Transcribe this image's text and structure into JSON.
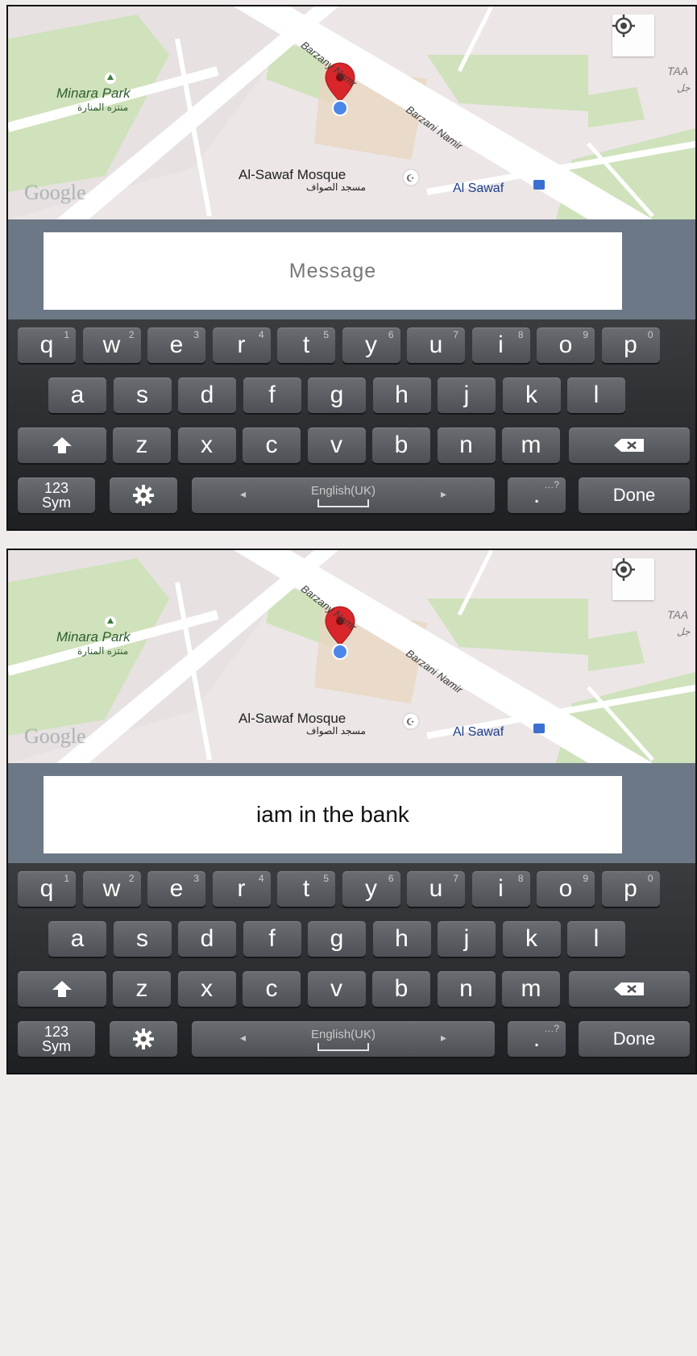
{
  "map": {
    "park_name": "Minara Park",
    "park_name_ar": "منتزه المنارة",
    "road_1": "Barzany Namr",
    "road_2": "Barzani Namir",
    "mosque_name": "Al-Sawaf Mosque",
    "mosque_name_ar": "مسجد الصواف",
    "bus_stop": "Al Sawaf",
    "edge_label": "TAA",
    "edge_label_ar": "جل",
    "watermark": "Google"
  },
  "panels": [
    {
      "message_text": "",
      "message_placeholder": "Message"
    },
    {
      "message_text": "iam in the bank",
      "message_placeholder": "Message"
    }
  ],
  "keyboard": {
    "row1": [
      {
        "label": "q",
        "hint": "1"
      },
      {
        "label": "w",
        "hint": "2"
      },
      {
        "label": "e",
        "hint": "3"
      },
      {
        "label": "r",
        "hint": "4"
      },
      {
        "label": "t",
        "hint": "5"
      },
      {
        "label": "y",
        "hint": "6"
      },
      {
        "label": "u",
        "hint": "7"
      },
      {
        "label": "i",
        "hint": "8"
      },
      {
        "label": "o",
        "hint": "9"
      },
      {
        "label": "p",
        "hint": "0"
      }
    ],
    "row2": [
      {
        "label": "a"
      },
      {
        "label": "s"
      },
      {
        "label": "d"
      },
      {
        "label": "f"
      },
      {
        "label": "g"
      },
      {
        "label": "h"
      },
      {
        "label": "j"
      },
      {
        "label": "k"
      },
      {
        "label": "l"
      }
    ],
    "row3": [
      {
        "label": "z"
      },
      {
        "label": "x"
      },
      {
        "label": "c"
      },
      {
        "label": "v"
      },
      {
        "label": "b"
      },
      {
        "label": "n"
      },
      {
        "label": "m"
      }
    ],
    "sym_top": "123",
    "sym_bottom": "Sym",
    "space_label": "English(UK)",
    "period": ".",
    "period_hint": "…?",
    "done": "Done",
    "icons": {
      "shift": "shift-arrow",
      "backspace": "backspace-x",
      "settings": "gear",
      "locate": "crosshair"
    }
  }
}
